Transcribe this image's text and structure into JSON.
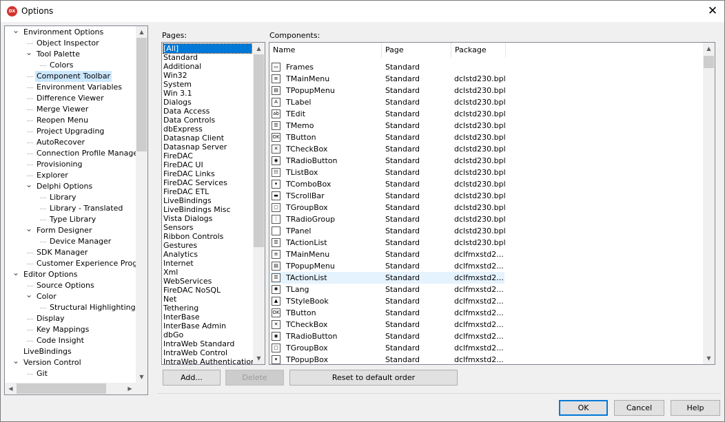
{
  "window": {
    "title": "Options",
    "app_icon_text": "DX"
  },
  "tree": {
    "items": [
      {
        "label": "Environment Options",
        "level": 0,
        "expander": "open"
      },
      {
        "label": "Object Inspector",
        "level": 1
      },
      {
        "label": "Tool Palette",
        "level": 1,
        "expander": "open"
      },
      {
        "label": "Colors",
        "level": 2
      },
      {
        "label": "Component Toolbar",
        "level": 1,
        "selected": true
      },
      {
        "label": "Environment Variables",
        "level": 1
      },
      {
        "label": "Difference Viewer",
        "level": 1
      },
      {
        "label": "Merge Viewer",
        "level": 1
      },
      {
        "label": "Reopen Menu",
        "level": 1
      },
      {
        "label": "Project Upgrading",
        "level": 1
      },
      {
        "label": "AutoRecover",
        "level": 1
      },
      {
        "label": "Connection Profile Manager",
        "level": 1
      },
      {
        "label": "Provisioning",
        "level": 1
      },
      {
        "label": "Explorer",
        "level": 1
      },
      {
        "label": "Delphi Options",
        "level": 1,
        "expander": "open"
      },
      {
        "label": "Library",
        "level": 2
      },
      {
        "label": "Library - Translated",
        "level": 2
      },
      {
        "label": "Type Library",
        "level": 2
      },
      {
        "label": "Form Designer",
        "level": 1,
        "expander": "open"
      },
      {
        "label": "Device Manager",
        "level": 2
      },
      {
        "label": "SDK Manager",
        "level": 1
      },
      {
        "label": "Customer Experience Program",
        "level": 1
      },
      {
        "label": "Editor Options",
        "level": 0,
        "expander": "open"
      },
      {
        "label": "Source Options",
        "level": 1
      },
      {
        "label": "Color",
        "level": 1,
        "expander": "open"
      },
      {
        "label": "Structural Highlighting",
        "level": 2
      },
      {
        "label": "Display",
        "level": 1
      },
      {
        "label": "Key Mappings",
        "level": 1
      },
      {
        "label": "Code Insight",
        "level": 1
      },
      {
        "label": "LiveBindings",
        "level": 0
      },
      {
        "label": "Version Control",
        "level": 0,
        "expander": "open"
      },
      {
        "label": "Git",
        "level": 1
      }
    ]
  },
  "pages": {
    "label": "Pages:",
    "items": [
      "[All]",
      "Standard",
      "Additional",
      "Win32",
      "System",
      "Win 3.1",
      "Dialogs",
      "Data Access",
      "Data Controls",
      "dbExpress",
      "Datasnap Client",
      "Datasnap Server",
      "FireDAC",
      "FireDAC UI",
      "FireDAC Links",
      "FireDAC Services",
      "FireDAC ETL",
      "LiveBindings",
      "LiveBindings Misc",
      "Vista Dialogs",
      "Sensors",
      "Ribbon Controls",
      "Gestures",
      "Analytics",
      "Internet",
      "Xml",
      "WebServices",
      "FireDAC NoSQL",
      "Net",
      "Tethering",
      "InterBase",
      "InterBase Admin",
      "dbGo",
      "IntraWeb Standard",
      "IntraWeb Control",
      "IntraWeb Authentication"
    ],
    "selected_index": 0
  },
  "components": {
    "label": "Components:",
    "columns": {
      "name": "Name",
      "page": "Page",
      "package": "Package"
    },
    "rows": [
      {
        "name": "Frames",
        "page": "Standard",
        "package": "",
        "icon": "frames-icon",
        "glyph": "▭"
      },
      {
        "name": "TMainMenu",
        "page": "Standard",
        "package": "dclstd230.bpl",
        "icon": "main-menu-icon",
        "glyph": "≡"
      },
      {
        "name": "TPopupMenu",
        "page": "Standard",
        "package": "dclstd230.bpl",
        "icon": "popup-menu-icon",
        "glyph": "▤"
      },
      {
        "name": "TLabel",
        "page": "Standard",
        "package": "dclstd230.bpl",
        "icon": "label-icon",
        "glyph": "A"
      },
      {
        "name": "TEdit",
        "page": "Standard",
        "package": "dclstd230.bpl",
        "icon": "edit-icon",
        "glyph": "ab"
      },
      {
        "name": "TMemo",
        "page": "Standard",
        "package": "dclstd230.bpl",
        "icon": "memo-icon",
        "glyph": "☰"
      },
      {
        "name": "TButton",
        "page": "Standard",
        "package": "dclstd230.bpl",
        "icon": "button-icon",
        "glyph": "OK"
      },
      {
        "name": "TCheckBox",
        "page": "Standard",
        "package": "dclstd230.bpl",
        "icon": "checkbox-icon",
        "glyph": "✕"
      },
      {
        "name": "TRadioButton",
        "page": "Standard",
        "package": "dclstd230.bpl",
        "icon": "radio-button-icon",
        "glyph": "◉"
      },
      {
        "name": "TListBox",
        "page": "Standard",
        "package": "dclstd230.bpl",
        "icon": "list-box-icon",
        "glyph": "☷"
      },
      {
        "name": "TComboBox",
        "page": "Standard",
        "package": "dclstd230.bpl",
        "icon": "combo-box-icon",
        "glyph": "▾"
      },
      {
        "name": "TScrollBar",
        "page": "Standard",
        "package": "dclstd230.bpl",
        "icon": "scroll-bar-icon",
        "glyph": "▬"
      },
      {
        "name": "TGroupBox",
        "page": "Standard",
        "package": "dclstd230.bpl",
        "icon": "group-box-icon",
        "glyph": "▢"
      },
      {
        "name": "TRadioGroup",
        "page": "Standard",
        "package": "dclstd230.bpl",
        "icon": "radio-group-icon",
        "glyph": "⋮"
      },
      {
        "name": "TPanel",
        "page": "Standard",
        "package": "dclstd230.bpl",
        "icon": "panel-icon",
        "glyph": ""
      },
      {
        "name": "TActionList",
        "page": "Standard",
        "package": "dclstd230.bpl",
        "icon": "action-list-icon",
        "glyph": "☰"
      },
      {
        "name": "TMainMenu",
        "page": "Standard",
        "package": "dclfmxstd2...",
        "icon": "main-menu-icon",
        "glyph": "≡"
      },
      {
        "name": "TPopupMenu",
        "page": "Standard",
        "package": "dclfmxstd2...",
        "icon": "popup-menu-icon",
        "glyph": "▤"
      },
      {
        "name": "TActionList",
        "page": "Standard",
        "package": "dclfmxstd2...",
        "icon": "action-list-icon",
        "glyph": "☰",
        "highlighted": true
      },
      {
        "name": "TLang",
        "page": "Standard",
        "package": "dclfmxstd2...",
        "icon": "lang-icon",
        "glyph": "✱"
      },
      {
        "name": "TStyleBook",
        "page": "Standard",
        "package": "dclfmxstd2...",
        "icon": "style-book-icon",
        "glyph": "▲"
      },
      {
        "name": "TButton",
        "page": "Standard",
        "package": "dclfmxstd2...",
        "icon": "button-icon",
        "glyph": "OK"
      },
      {
        "name": "TCheckBox",
        "page": "Standard",
        "package": "dclfmxstd2...",
        "icon": "checkbox-icon",
        "glyph": "✕"
      },
      {
        "name": "TRadioButton",
        "page": "Standard",
        "package": "dclfmxstd2...",
        "icon": "radio-button-icon",
        "glyph": "◉"
      },
      {
        "name": "TGroupBox",
        "page": "Standard",
        "package": "dclfmxstd2...",
        "icon": "group-box-icon",
        "glyph": "▢"
      },
      {
        "name": "TPopupBox",
        "page": "Standard",
        "package": "dclfmxstd2...",
        "icon": "popup-box-icon",
        "glyph": "▾"
      }
    ]
  },
  "buttons": {
    "add": "Add...",
    "delete": "Delete",
    "reset": "Reset to default order",
    "ok": "OK",
    "cancel": "Cancel",
    "help": "Help"
  },
  "colors": {
    "selection": "#cce8ff",
    "hover": "#e5f3ff",
    "accent": "#0078d7"
  }
}
